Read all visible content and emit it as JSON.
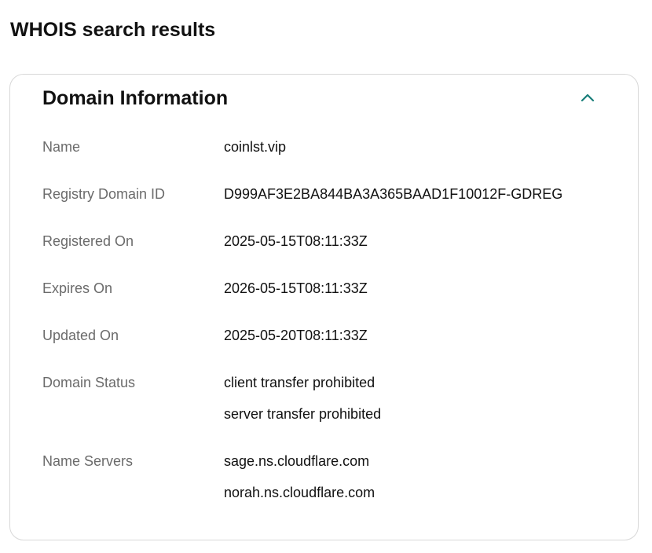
{
  "page": {
    "title": "WHOIS search results"
  },
  "card": {
    "title": "Domain Information",
    "toggle_icon": "chevron-up-icon",
    "accent_color": "#1a7f7a"
  },
  "fields": [
    {
      "label": "Name",
      "values": [
        "coinlst.vip"
      ]
    },
    {
      "label": "Registry Domain ID",
      "values": [
        "D999AF3E2BA844BA3A365BAAD1F10012F-GDREG"
      ]
    },
    {
      "label": "Registered On",
      "values": [
        "2025-05-15T08:11:33Z"
      ]
    },
    {
      "label": "Expires On",
      "values": [
        "2026-05-15T08:11:33Z"
      ]
    },
    {
      "label": "Updated On",
      "values": [
        "2025-05-20T08:11:33Z"
      ]
    },
    {
      "label": "Domain Status",
      "values": [
        "client transfer prohibited",
        "server transfer prohibited"
      ]
    },
    {
      "label": "Name Servers",
      "values": [
        "sage.ns.cloudflare.com",
        "norah.ns.cloudflare.com"
      ]
    }
  ]
}
